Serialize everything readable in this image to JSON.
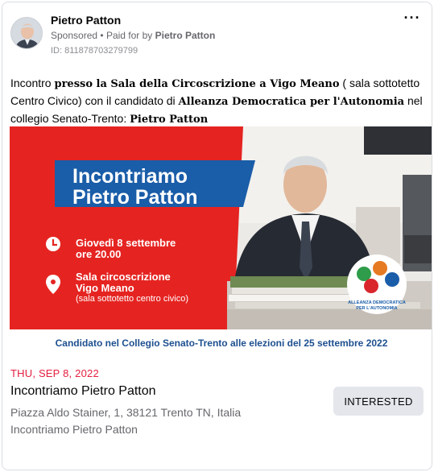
{
  "post": {
    "author": "Pietro Patton",
    "sponsored": "Sponsored",
    "separator": "•",
    "paid_prefix": "Paid for by",
    "paid_by": "Pietro Patton",
    "ad_id": "ID: 811878703279799",
    "more_icon": "more-horizontal-icon",
    "body": [
      {
        "text": "Incontro ",
        "bold": false
      },
      {
        "text": "presso la Sala della Circoscrizione a Vigo Meano",
        "bold": true
      },
      {
        "text": " ( sala sottotetto Centro Civico) con il candidato di ",
        "bold": false
      },
      {
        "text": "Alleanza Democratica per l'Autonomia",
        "bold": true
      },
      {
        "text": " nel collegio Senato-Trento: ",
        "bold": false
      },
      {
        "text": "Pietro Patton",
        "bold": true
      }
    ]
  },
  "banner": {
    "headline_1": "Incontriamo",
    "headline_2": "Pietro Patton",
    "when_1": "Giovedì 8 settembre",
    "when_2": "ore 20.00",
    "where_1": "Sala circoscrizione",
    "where_2": "Vigo Meano",
    "where_3": "(sala sottotetto centro civico)",
    "footer": "Candidato nel Collegio Senato-Trento alle elezioni del 25 settembre 2022",
    "logo_1": "ALLEANZA DEMOCRATICA",
    "logo_2": "PER L'AUTONOMIA",
    "colors": {
      "red": "#e52421",
      "blue": "#1a5da8",
      "footer_text": "#1d4f8f"
    }
  },
  "event": {
    "date": "THU, SEP 8, 2022",
    "title": "Incontriamo Pietro Patton",
    "address": "Piazza Aldo Stainer, 1, 38121 Trento TN, Italia",
    "organizer": "Incontriamo Pietro Patton",
    "button": "INTERESTED"
  }
}
